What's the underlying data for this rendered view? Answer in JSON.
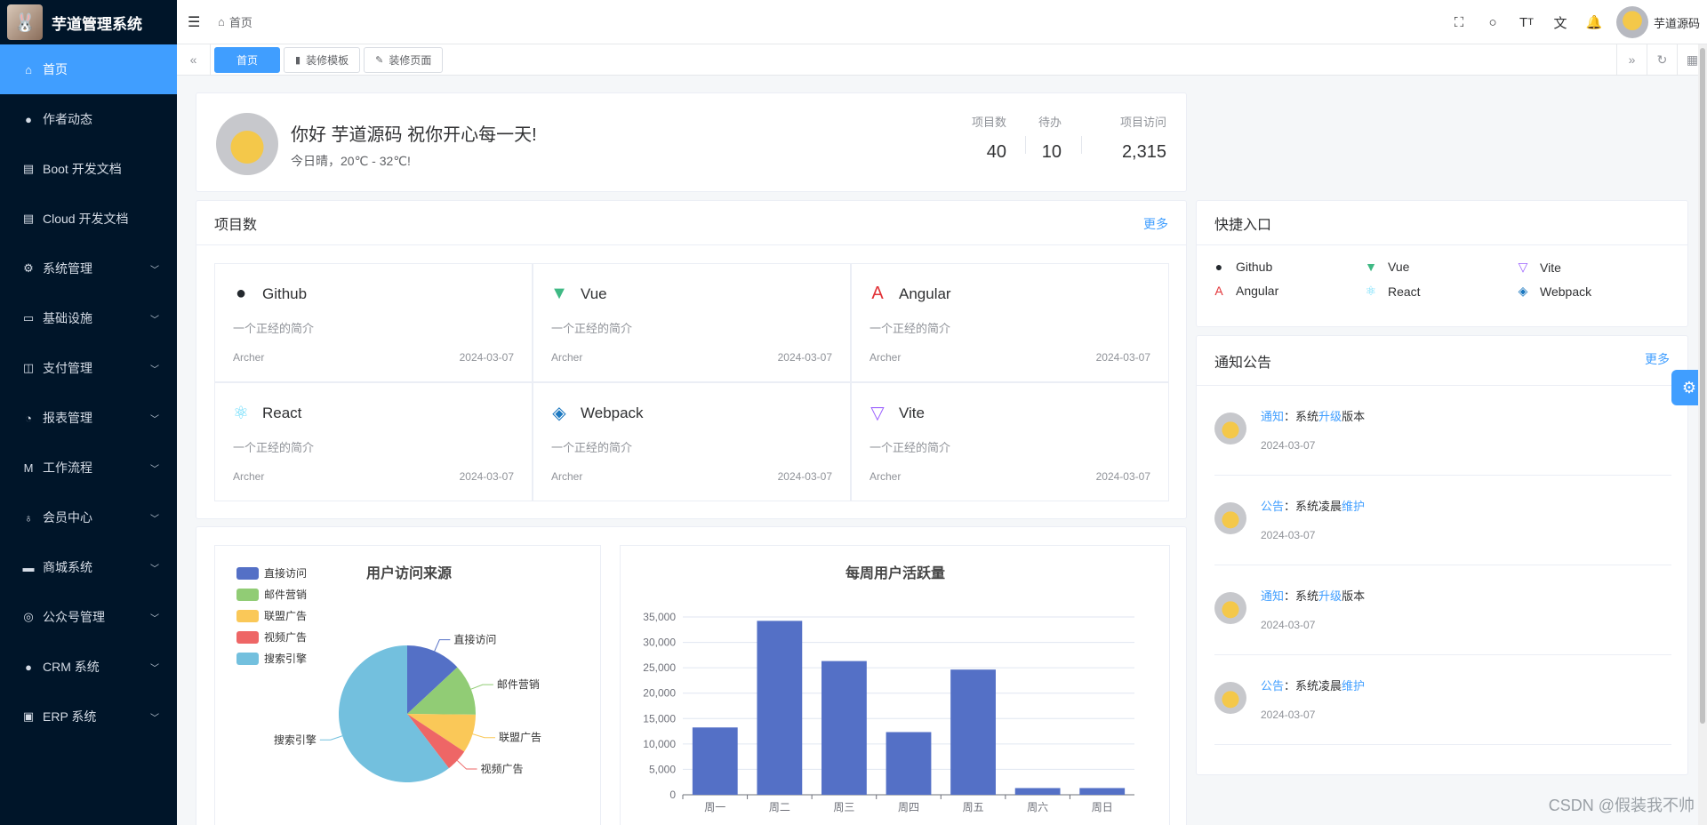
{
  "app": {
    "title": "芋道管理系统"
  },
  "sidebar": {
    "items": [
      {
        "label": "首页",
        "icon": "home-icon",
        "active": true,
        "expandable": false
      },
      {
        "label": "作者动态",
        "icon": "user-icon",
        "expandable": false
      },
      {
        "label": "Boot 开发文档",
        "icon": "document-icon",
        "expandable": false
      },
      {
        "label": "Cloud 开发文档",
        "icon": "document-icon",
        "expandable": false
      },
      {
        "label": "系统管理",
        "icon": "gear-icon",
        "expandable": true
      },
      {
        "label": "基础设施",
        "icon": "monitor-icon",
        "expandable": true
      },
      {
        "label": "支付管理",
        "icon": "payment-icon",
        "expandable": true
      },
      {
        "label": "报表管理",
        "icon": "chart-icon",
        "expandable": true
      },
      {
        "label": "工作流程",
        "icon": "workflow-icon",
        "expandable": true
      },
      {
        "label": "会员中心",
        "icon": "member-icon",
        "expandable": true
      },
      {
        "label": "商城系统",
        "icon": "shop-icon",
        "expandable": true
      },
      {
        "label": "公众号管理",
        "icon": "compass-icon",
        "expandable": true
      },
      {
        "label": "CRM 系统",
        "icon": "user-icon",
        "expandable": true
      },
      {
        "label": "ERP 系统",
        "icon": "box-icon",
        "expandable": true
      }
    ]
  },
  "header": {
    "breadcrumb": "首页",
    "user_name": "芋道源码",
    "tools": [
      "fullscreen-icon",
      "search-icon",
      "font-size-icon",
      "translate-icon",
      "bell-icon"
    ]
  },
  "tabs": [
    {
      "label": "首页",
      "active": true,
      "icon": ""
    },
    {
      "label": "装修模板",
      "active": false,
      "icon": "template-icon"
    },
    {
      "label": "装修页面",
      "active": false,
      "icon": "edit-icon"
    }
  ],
  "welcome": {
    "title": "你好 芋道源码 祝你开心每一天!",
    "subtitle": "今日晴，20℃ - 32℃!",
    "stats": [
      {
        "label": "项目数",
        "value": "40"
      },
      {
        "label": "待办",
        "value": "10"
      },
      {
        "label": "项目访问",
        "value": "2,315"
      }
    ]
  },
  "projects": {
    "title": "项目数",
    "more": "更多",
    "items": [
      {
        "name": "Github",
        "icon": "github-icon",
        "desc": "一个正经的简介",
        "author": "Archer",
        "date": "2024-03-07",
        "color": "#24292e"
      },
      {
        "name": "Vue",
        "icon": "vue-icon",
        "desc": "一个正经的简介",
        "author": "Archer",
        "date": "2024-03-07",
        "color": "#3fb984"
      },
      {
        "name": "Angular",
        "icon": "angular-icon",
        "desc": "一个正经的简介",
        "author": "Archer",
        "date": "2024-03-07",
        "color": "#e23237"
      },
      {
        "name": "React",
        "icon": "react-icon",
        "desc": "一个正经的简介",
        "author": "Archer",
        "date": "2024-03-07",
        "color": "#61dafb"
      },
      {
        "name": "Webpack",
        "icon": "webpack-icon",
        "desc": "一个正经的简介",
        "author": "Archer",
        "date": "2024-03-07",
        "color": "#1c78c0"
      },
      {
        "name": "Vite",
        "icon": "vite-icon",
        "desc": "一个正经的简介",
        "author": "Archer",
        "date": "2024-03-07",
        "color": "#9c62fe"
      }
    ]
  },
  "quick": {
    "title": "快捷入口",
    "items": [
      {
        "name": "Github",
        "icon": "github-icon",
        "color": "#24292e"
      },
      {
        "name": "Vue",
        "icon": "vue-icon",
        "color": "#3fb984"
      },
      {
        "name": "Vite",
        "icon": "vite-icon",
        "color": "#9c62fe"
      },
      {
        "name": "Angular",
        "icon": "angular-icon",
        "color": "#e23237"
      },
      {
        "name": "React",
        "icon": "react-icon",
        "color": "#61dafb"
      },
      {
        "name": "Webpack",
        "icon": "webpack-icon",
        "color": "#1c78c0"
      }
    ]
  },
  "notice": {
    "title": "通知公告",
    "more": "更多",
    "items": [
      {
        "type": "通知",
        "sep": "：",
        "pre": "系统",
        "hl": "升级",
        "post": "版本",
        "date": "2024-03-07"
      },
      {
        "type": "公告",
        "sep": "：",
        "pre": "系统凌晨",
        "hl": "维护",
        "post": "",
        "date": "2024-03-07"
      },
      {
        "type": "通知",
        "sep": "：",
        "pre": "系统",
        "hl": "升级",
        "post": "版本",
        "date": "2024-03-07"
      },
      {
        "type": "公告",
        "sep": "：",
        "pre": "系统凌晨",
        "hl": "维护",
        "post": "",
        "date": "2024-03-07"
      }
    ]
  },
  "chart_data": [
    {
      "type": "pie",
      "title": "用户访问来源",
      "legend_position": "top-left",
      "slices": [
        {
          "name": "直接访问",
          "value": 335,
          "color": "#5470c6"
        },
        {
          "name": "邮件营销",
          "value": 310,
          "color": "#91cc75"
        },
        {
          "name": "联盟广告",
          "value": 234,
          "color": "#fac858"
        },
        {
          "name": "视频广告",
          "value": 135,
          "color": "#ee6666"
        },
        {
          "name": "搜索引擎",
          "value": 1548,
          "color": "#73c0de"
        }
      ]
    },
    {
      "type": "bar",
      "title": "每周用户活跃量",
      "categories": [
        "周一",
        "周二",
        "周三",
        "周四",
        "周五",
        "周六",
        "周日"
      ],
      "values": [
        13253,
        34235,
        26321,
        12340,
        24643,
        1322,
        1324
      ],
      "yticks": [
        "0",
        "5,000",
        "10,000",
        "15,000",
        "20,000",
        "25,000",
        "30,000",
        "35,000"
      ],
      "ylim": [
        0,
        35000
      ],
      "color": "#5470c6",
      "grid": true
    }
  ],
  "watermark": "CSDN @假装我不帅"
}
